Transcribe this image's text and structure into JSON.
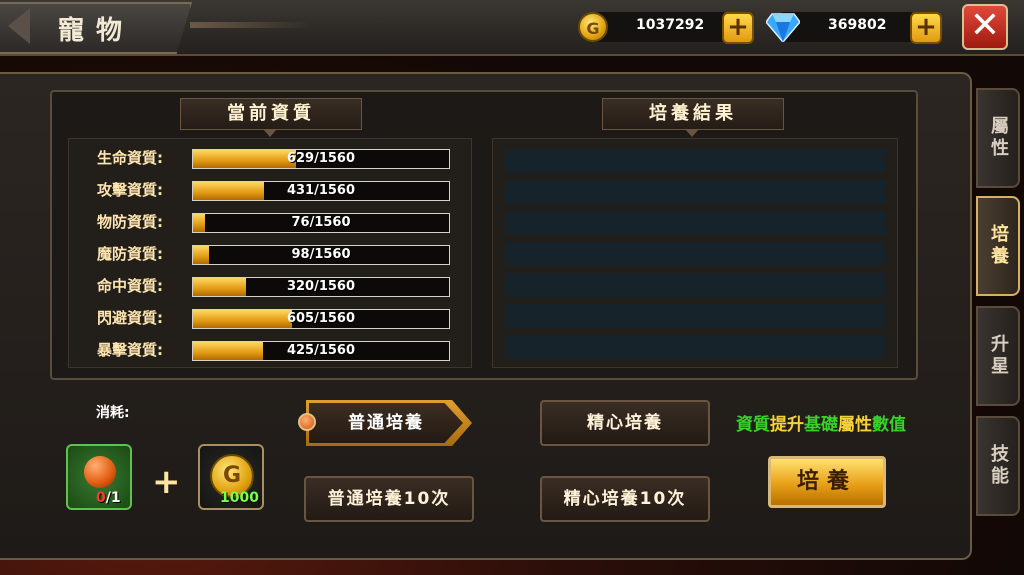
{
  "header": {
    "title": "寵物",
    "gold": "1037292",
    "gems": "369802",
    "coin_glyph": "G",
    "plus_glyph": "+",
    "close_glyph": "✕"
  },
  "current_title": "當前資質",
  "result_title": "培養結果",
  "stats": [
    {
      "label": "生命資質:",
      "value": 629,
      "max": 1560,
      "text": "629/1560"
    },
    {
      "label": "攻擊資質:",
      "value": 431,
      "max": 1560,
      "text": "431/1560"
    },
    {
      "label": "物防資質:",
      "value": 76,
      "max": 1560,
      "text": "76/1560"
    },
    {
      "label": "魔防資質:",
      "value": 98,
      "max": 1560,
      "text": "98/1560"
    },
    {
      "label": "命中資質:",
      "value": 320,
      "max": 1560,
      "text": "320/1560"
    },
    {
      "label": "閃避資質:",
      "value": 605,
      "max": 1560,
      "text": "605/1560"
    },
    {
      "label": "暴擊資質:",
      "value": 425,
      "max": 1560,
      "text": "425/1560"
    }
  ],
  "consume": {
    "label": "消耗:",
    "item_have": "0",
    "item_need": "/1",
    "gold_cost": "1000",
    "plus": "+"
  },
  "modes": {
    "normal": "普通培養",
    "careful": "精心培養",
    "normal10": "普通培養10次",
    "careful10": "精心培養10次"
  },
  "hint": [
    {
      "text": "資質",
      "color": "#39d12a"
    },
    {
      "text": "提升",
      "color": "#f5d23a"
    },
    {
      "text": "基礎",
      "color": "#39d12a"
    },
    {
      "text": "屬性",
      "color": "#f5d23a"
    },
    {
      "text": "數值",
      "color": "#39d12a"
    }
  ],
  "cultivate_label": "培養",
  "tabs": [
    "屬性",
    "培養",
    "升星",
    "技能"
  ],
  "active_tab": 1,
  "colors": {
    "accent_gold": "#e0a014",
    "hint_green": "#39d12a",
    "hint_yellow": "#f5d23a"
  }
}
